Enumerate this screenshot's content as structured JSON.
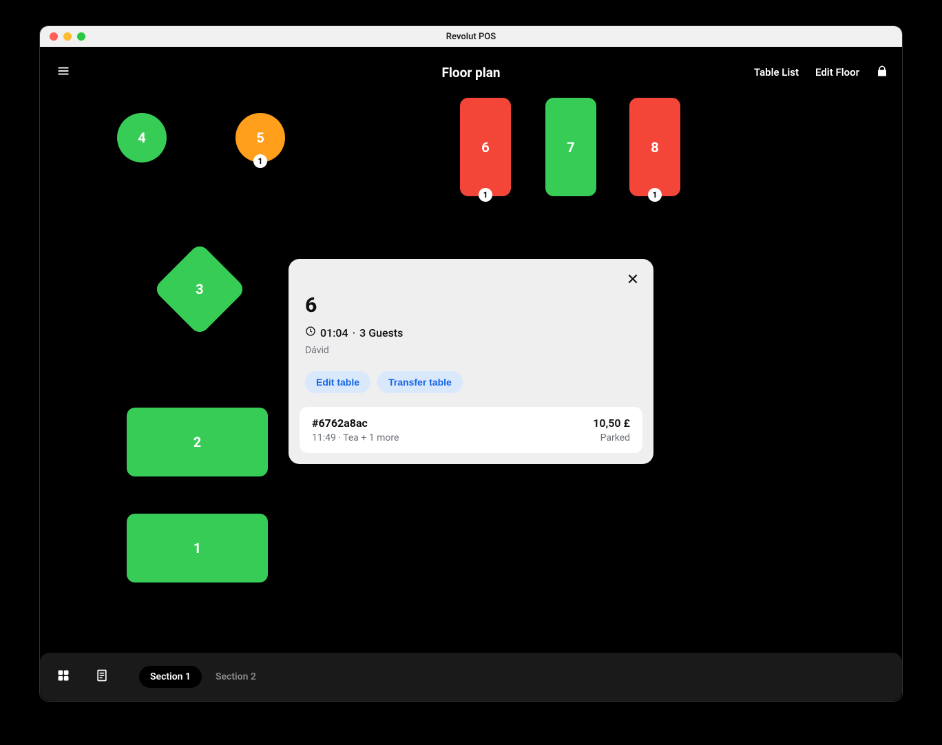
{
  "window": {
    "title": "Revolut POS"
  },
  "topbar": {
    "title": "Floor plan",
    "table_list": "Table List",
    "edit_floor": "Edit Floor"
  },
  "tables": {
    "t1": {
      "label": "1"
    },
    "t2": {
      "label": "2"
    },
    "t3": {
      "label": "3"
    },
    "t4": {
      "label": "4"
    },
    "t5": {
      "label": "5",
      "badge": "1"
    },
    "t6": {
      "label": "6",
      "badge": "1"
    },
    "t7": {
      "label": "7"
    },
    "t8": {
      "label": "8",
      "badge": "1"
    }
  },
  "popover": {
    "title": "6",
    "time": "01:04",
    "guests": "3 Guests",
    "server": "Dávid",
    "edit_label": "Edit table",
    "transfer_label": "Transfer table",
    "order": {
      "id": "#6762a8ac",
      "desc": "11:49 · Tea + 1 more",
      "price": "10,50 £",
      "status": "Parked"
    }
  },
  "bottombar": {
    "sections": [
      "Section 1",
      "Section 2"
    ]
  }
}
